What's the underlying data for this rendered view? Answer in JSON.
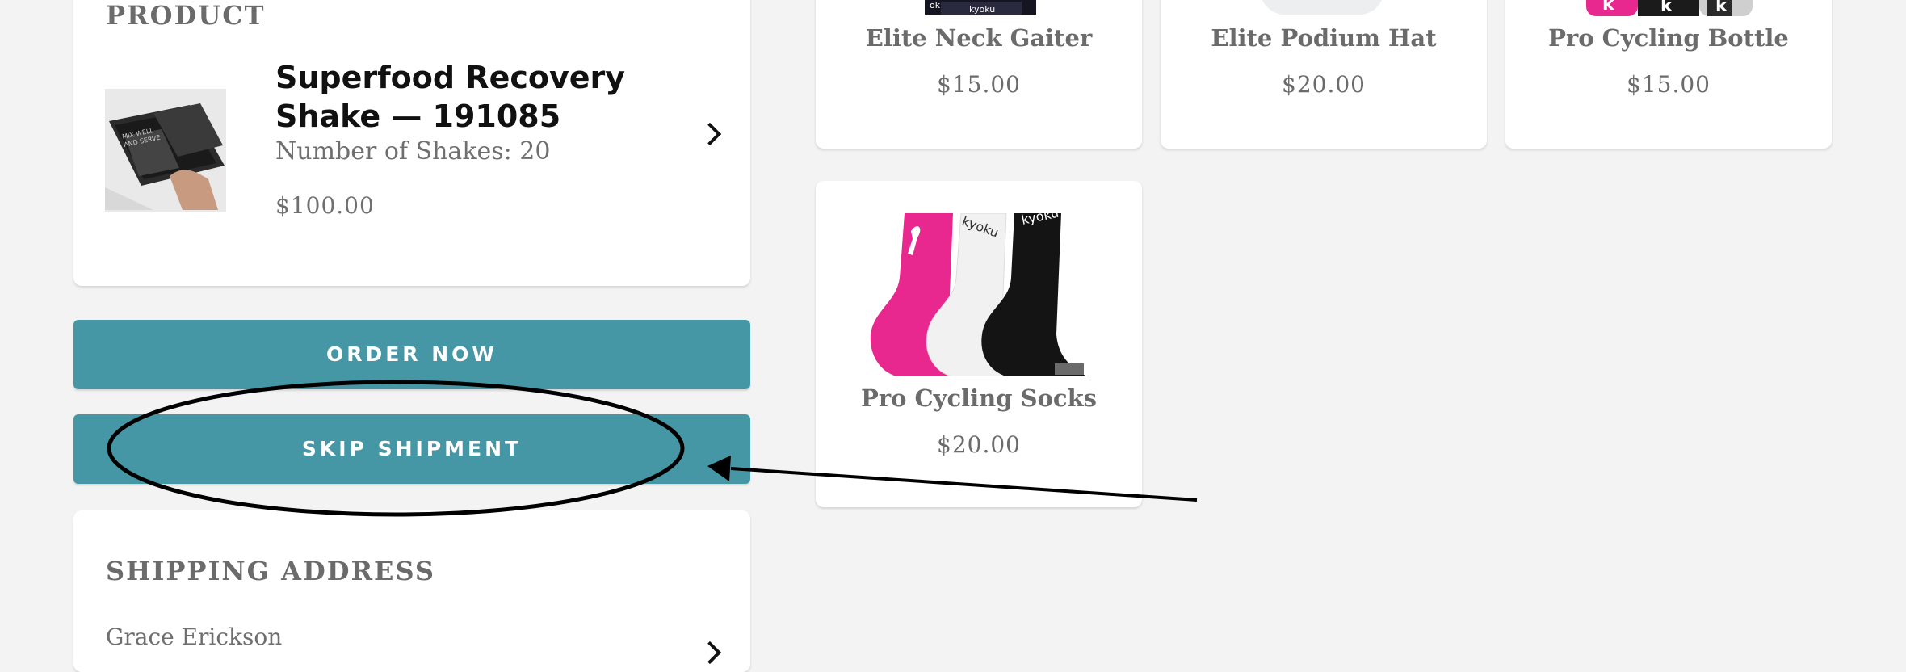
{
  "product": {
    "heading": "PRODUCT",
    "name": "Superfood Recovery Shake — 191085",
    "variant": "Number of Shakes: 20",
    "price": "$100.00",
    "image_alt": "Superfood Recovery Shake box"
  },
  "actions": {
    "order_now": "ORDER NOW",
    "skip_shipment": "SKIP SHIPMENT"
  },
  "shipping": {
    "heading": "SHIPPING ADDRESS",
    "name": "Grace Erickson"
  },
  "recommendations": [
    {
      "name": "Elite Neck Gaiter",
      "price": "$15.00"
    },
    {
      "name": "Elite Podium Hat",
      "price": "$20.00"
    },
    {
      "name": "Pro Cycling Bottle",
      "price": "$15.00"
    },
    {
      "name": "Pro Cycling Socks",
      "price": "$20.00"
    }
  ],
  "colors": {
    "button": "#4697a6",
    "background": "#f3f3f3",
    "card": "#ffffff",
    "annotation": "#000000",
    "socks_pink": "#e8288f"
  },
  "icons": [
    "chevron-right-icon",
    "annotation-ellipse",
    "annotation-arrow"
  ]
}
